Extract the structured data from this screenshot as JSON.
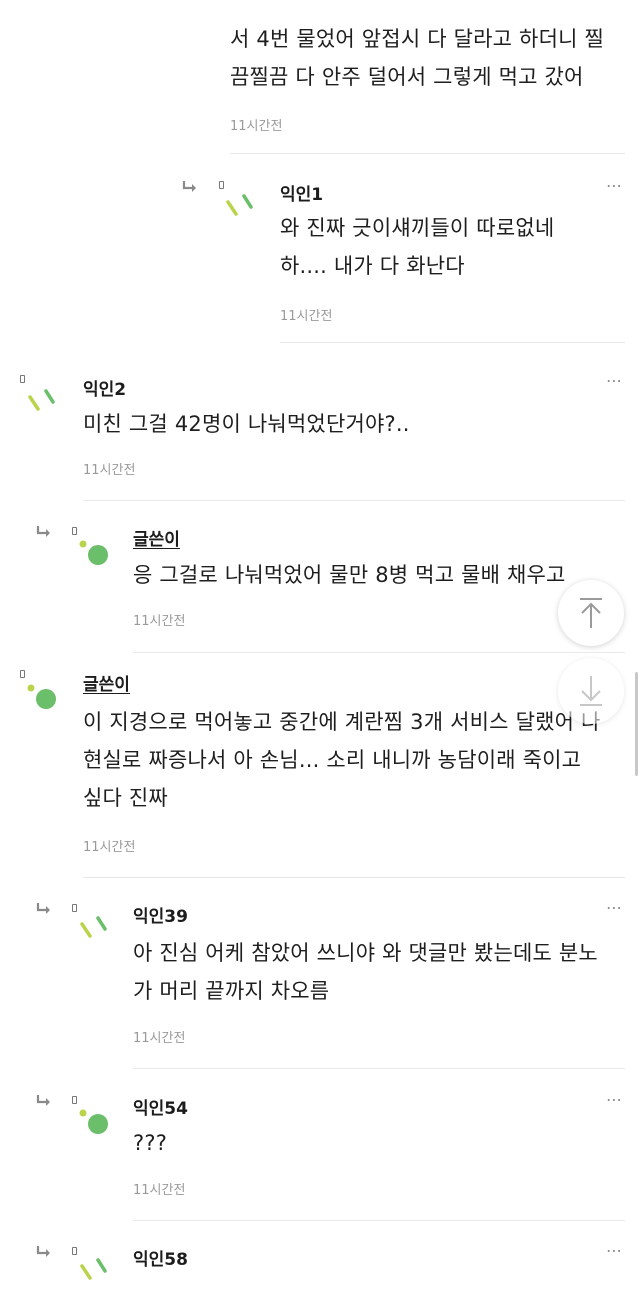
{
  "comments": [
    {
      "text": "서 4번 물었어 앞접시 다 달라고 하더니 찔\n끔찔끔 다 안주 덜어서 그렇게 먹고 갔어",
      "time": "11시간전"
    },
    {
      "author": "익인1",
      "text": "와 진짜 긋이섀끼들이 따로없네\n하.... 내가 다 화난다",
      "time": "11시간전",
      "avatar": "green-lines"
    },
    {
      "author": "익인2",
      "text": "미친 그걸 42명이 나눠먹었단거야?..",
      "time": "11시간전",
      "avatar": "green-lines"
    },
    {
      "author": "글쓴이",
      "text": "응 그걸로 나눠먹었어 물만 8병 먹고 물배 채우고",
      "time": "11시간전",
      "avatar": "green-dots"
    },
    {
      "author": "글쓴이",
      "text": "이 지경으로 먹어놓고 중간에 계란찜 3개 서비스 달랬어 나\n현실로 짜증나서 아 손님... 소리 내니까 농담이래 죽이고\n싶다 진짜",
      "time": "11시간전",
      "avatar": "green-dots"
    },
    {
      "author": "익인39",
      "text": "아 진심 어케 참았어 쓰니야 와 댓글만 봤는데도 분노\n가 머리 끝까지 차오름",
      "time": "11시간전",
      "avatar": "green-lines"
    },
    {
      "author": "익인54",
      "text": "???",
      "time": "11시간전",
      "avatar": "green-dots"
    },
    {
      "author": "익인58",
      "avatar": "green-lines"
    }
  ],
  "more_icon": "⋯",
  "buttons": {
    "scroll_top_icon": "arrow-up-icon",
    "scroll_bottom_icon": "arrow-down-icon"
  },
  "colors": {
    "avatar_green": "#6bbf6a",
    "avatar_lime": "#b9d34a",
    "divider": "#e9e9e9"
  }
}
